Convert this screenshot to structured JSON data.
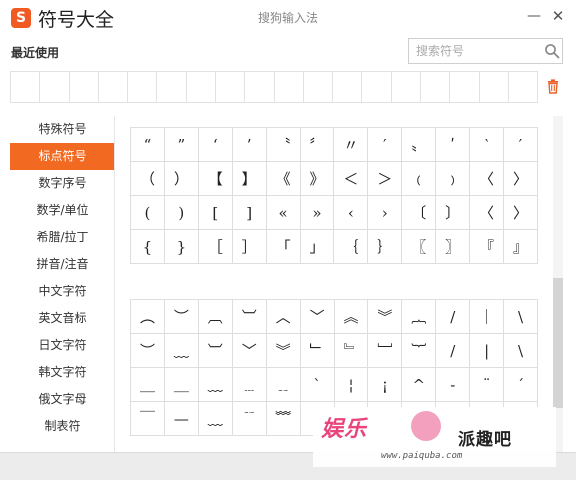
{
  "app": {
    "logo_letter": "S",
    "title": "符号大全",
    "window_title": "搜狗输入法",
    "minimize": "—",
    "close": "✕"
  },
  "recent": {
    "label": "最近使用",
    "cells": 18
  },
  "search": {
    "placeholder": "搜索符号"
  },
  "sidebar": {
    "active_index": 1,
    "items": [
      "特殊符号",
      "标点符号",
      "数字序号",
      "数学/单位",
      "希腊/拉丁",
      "拼音/注音",
      "中文字符",
      "英文音标",
      "日文字符",
      "韩文字符",
      "俄文字母",
      "制表符"
    ]
  },
  "punctuation_grid": [
    [
      "“",
      "”",
      "‘",
      "’",
      "〝",
      "〞",
      "〃",
      "′",
      "〟",
      "ʹ",
      "‵",
      "′"
    ],
    [
      "（",
      "）",
      "【",
      "】",
      "《",
      "》",
      "＜",
      "＞",
      "﹙",
      "﹚",
      "〈",
      "〉"
    ],
    [
      "(",
      ")",
      "[",
      "]",
      "«",
      "»",
      "‹",
      "›",
      "〔",
      "〕",
      "〈",
      "〉"
    ],
    [
      "{",
      "}",
      "［",
      "］",
      "「",
      "」",
      "｛",
      "｝",
      "〖",
      "〗",
      "『",
      "』"
    ]
  ],
  "box_grid": [
    [
      "︵",
      "︶",
      "︹",
      "︺",
      "︿",
      "﹀",
      "︽",
      "︾",
      "︷",
      "/",
      "｜",
      "\\"
    ],
    [
      "︶",
      "﹏",
      "︺",
      "﹀",
      "︾",
      "﹂",
      "﹄",
      "﹈",
      "︸",
      "/",
      "|",
      "\\"
    ],
    [
      "＿",
      "＿",
      "﹏",
      "﹍",
      "﹎",
      "ˋ",
      "¦",
      "¡",
      "^",
      "-",
      "¨",
      "ˊ"
    ],
    [
      "￣",
      "—",
      "﹏",
      "﹊",
      "﹌",
      "",
      "",
      "",
      "",
      "",
      "",
      ""
    ]
  ],
  "watermark": {
    "logo": "娱乐",
    "name": "派趣吧",
    "url": "www.paiquba.com"
  },
  "colors": {
    "accent": "#f26a21",
    "logo_bg": "#f15a22"
  }
}
